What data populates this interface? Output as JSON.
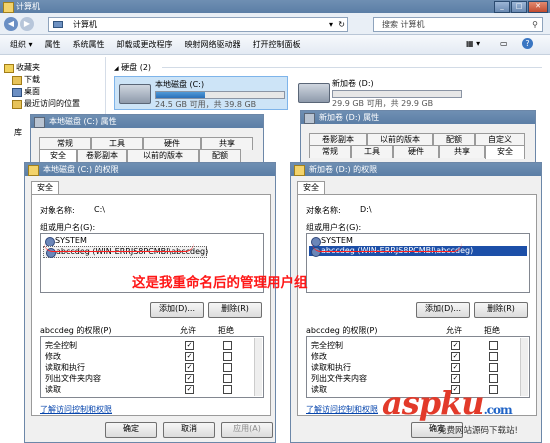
{
  "explorer": {
    "title": "计算机",
    "address": "计算机",
    "search_placeholder": "搜索 计算机",
    "menu": [
      "组织",
      "属性",
      "系统属性",
      "卸载或更改程序",
      "映射网络驱动器",
      "打开控制面板"
    ],
    "sidebar": [
      "收藏夹",
      "下载",
      "桌面",
      "最近访问的位置"
    ],
    "sidebar_extra": "库",
    "section_title": "硬盘 (2)",
    "drives": [
      {
        "name": "本地磁盘 (C:)",
        "info": "24.5 GB 可用，共 39.8 GB",
        "used_fraction": 0.38
      },
      {
        "name": "新加卷 (D:)",
        "info": "29.9 GB 可用，共 29.9 GB",
        "used_fraction": 0.0
      }
    ]
  },
  "props_c": {
    "title": "本地磁盘 (C:) 属性",
    "tabs_row1": [
      "常规",
      "工具",
      "硬件",
      "共享"
    ],
    "tabs_row2": [
      "安全",
      "卷影副本",
      "以前的版本",
      "配额"
    ]
  },
  "props_d": {
    "title": "新加卷 (D:) 属性",
    "tabs_row1": [
      "卷影副本",
      "以前的版本",
      "配额",
      "自定义"
    ],
    "tabs_row2": [
      "常规",
      "工具",
      "硬件",
      "共享",
      "安全"
    ]
  },
  "perm_c": {
    "title": "本地磁盘 (C:) 的权限",
    "tab": "安全",
    "object_label": "对象名称:",
    "object_value": "C:\\",
    "group_label": "组或用户名(G):",
    "users": [
      "SYSTEM",
      "abccdeg (WIN-ERRJS8PCMBI\\abccdeg)"
    ],
    "selected_user": 1,
    "add_button": "添加(D)...",
    "remove_button": "删除(R)",
    "perm_header": "abccdeg 的权限(P)",
    "allow_header": "允许",
    "deny_header": "拒绝",
    "permissions": [
      {
        "name": "完全控制",
        "allow": true,
        "deny": false
      },
      {
        "name": "修改",
        "allow": true,
        "deny": false
      },
      {
        "name": "读取和执行",
        "allow": true,
        "deny": false
      },
      {
        "name": "列出文件夹内容",
        "allow": true,
        "deny": false
      },
      {
        "name": "读取",
        "allow": true,
        "deny": false
      }
    ],
    "link": "了解访问控制和权限",
    "ok_button": "确定",
    "cancel_button": "取消",
    "apply_button": "应用(A)"
  },
  "perm_d": {
    "title": "新加卷 (D:) 的权限",
    "tab": "安全",
    "object_label": "对象名称:",
    "object_value": "D:\\",
    "group_label": "组或用户名(G):",
    "users": [
      "SYSTEM",
      "abccdeg (WIN-ERRJS8PCMBI\\abccdeg)"
    ],
    "selected_user": 1,
    "add_button": "添加(D)...",
    "remove_button": "删除(R)",
    "perm_header": "abccdeg 的权限(P)",
    "allow_header": "允许",
    "deny_header": "拒绝",
    "permissions": [
      {
        "name": "完全控制",
        "allow": true,
        "deny": false
      },
      {
        "name": "修改",
        "allow": true,
        "deny": false
      },
      {
        "name": "读取和执行",
        "allow": true,
        "deny": false
      },
      {
        "name": "列出文件夹内容",
        "allow": true,
        "deny": false
      },
      {
        "name": "读取",
        "allow": true,
        "deny": false
      }
    ],
    "link": "了解访问控制和权限",
    "ok_button": "确定"
  },
  "annotation": "这是我重命名后的管理用户组",
  "watermark": {
    "brand": "aspku",
    "suffix": ".com",
    "tagline": "免费网站源码下载站!"
  },
  "colors": {
    "annotation": "#ff1717",
    "selection": "#1c4fa8",
    "watermark_red": "#e23a2a",
    "watermark_blue": "#1f63c6"
  }
}
